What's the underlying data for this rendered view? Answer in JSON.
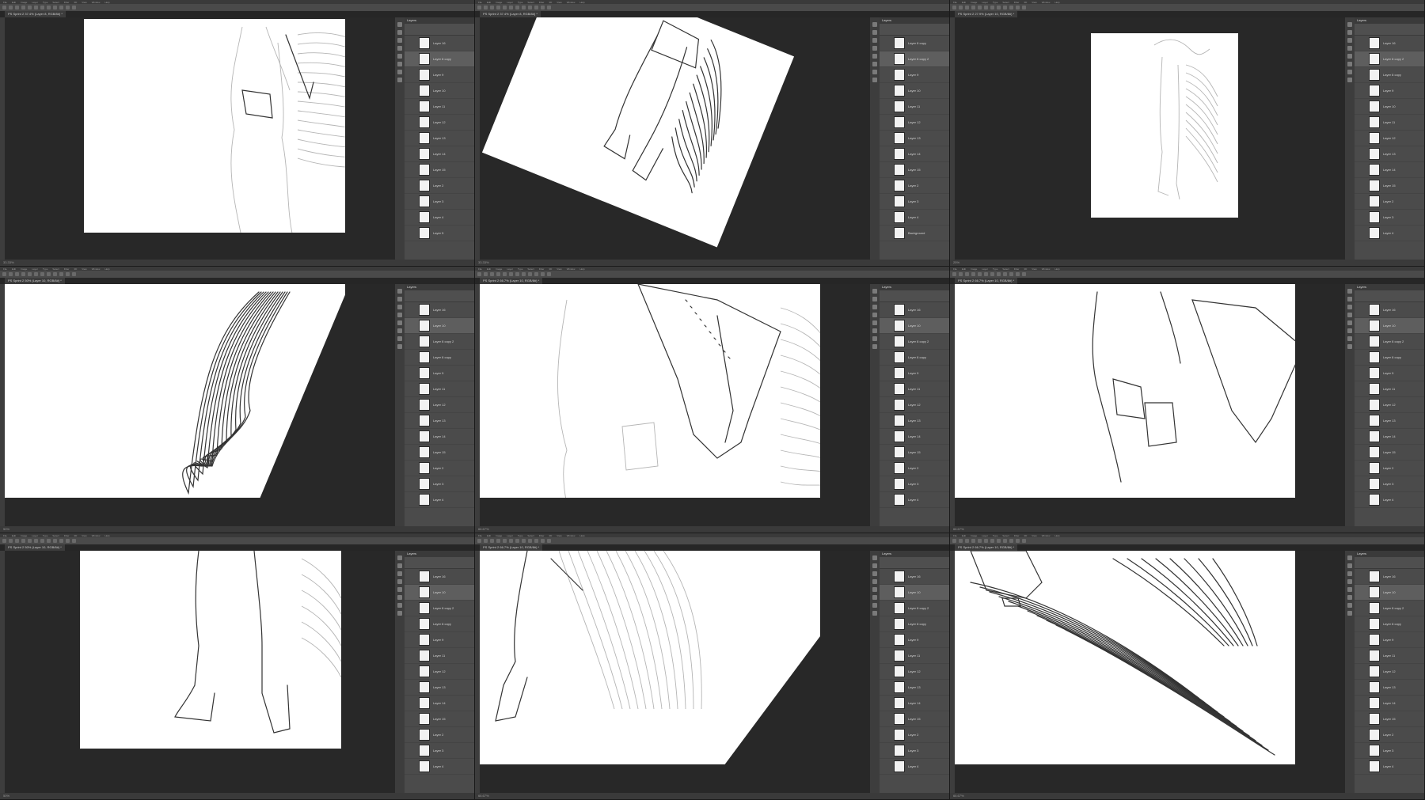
{
  "app": {
    "menu_items": [
      "File",
      "Edit",
      "Image",
      "Layer",
      "Type",
      "Select",
      "Filter",
      "3D",
      "View",
      "Window",
      "Help"
    ],
    "layers_panel_title": "Layers"
  },
  "cells": [
    {
      "doc_tab": "PS Sprint 2 37.4% (Layer 8, RGB/8#) *",
      "status": "33.33%",
      "layers": [
        "Layer 16",
        "Layer 8 copy",
        "Layer 9",
        "Layer 10",
        "Layer 11",
        "Layer 12",
        "Layer 13",
        "Layer 14",
        "Layer 15",
        "Layer 2",
        "Layer 3",
        "Layer 4",
        "Layer 5"
      ]
    },
    {
      "doc_tab": "PS Sprint 2 37.4% (Layer 8, RGB/8#) *",
      "status": "33.33%",
      "layers": [
        "Layer 8 copy",
        "Layer 8 copy 2",
        "Layer 9",
        "Layer 10",
        "Layer 11",
        "Layer 12",
        "Layer 13",
        "Layer 14",
        "Layer 15",
        "Layer 2",
        "Layer 3",
        "Layer 4",
        "Background"
      ]
    },
    {
      "doc_tab": "PS Sprint 2 27.9% (Layer 10, RGB/8#) *",
      "status": "25%",
      "layers": [
        "Layer 16",
        "Layer 8 copy 2",
        "Layer 8 copy",
        "Layer 9",
        "Layer 10",
        "Layer 11",
        "Layer 12",
        "Layer 13",
        "Layer 14",
        "Layer 15",
        "Layer 2",
        "Layer 3",
        "Layer 4"
      ]
    },
    {
      "doc_tab": "PS Sprint 2 50% (Layer 10, RGB/8#) *",
      "status": "50%",
      "layers": [
        "Layer 16",
        "Layer 10",
        "Layer 8 copy 2",
        "Layer 8 copy",
        "Layer 9",
        "Layer 11",
        "Layer 12",
        "Layer 13",
        "Layer 14",
        "Layer 15",
        "Layer 2",
        "Layer 3",
        "Layer 4"
      ]
    },
    {
      "doc_tab": "PS Sprint 2 66.7% (Layer 10, RGB/8#) *",
      "status": "66.67%",
      "layers": [
        "Layer 16",
        "Layer 10",
        "Layer 8 copy 2",
        "Layer 8 copy",
        "Layer 9",
        "Layer 11",
        "Layer 12",
        "Layer 13",
        "Layer 14",
        "Layer 15",
        "Layer 2",
        "Layer 3",
        "Layer 4"
      ]
    },
    {
      "doc_tab": "PS Sprint 2 66.7% (Layer 10, RGB/8#) *",
      "status": "66.67%",
      "layers": [
        "Layer 16",
        "Layer 10",
        "Layer 8 copy 2",
        "Layer 8 copy",
        "Layer 9",
        "Layer 11",
        "Layer 12",
        "Layer 13",
        "Layer 14",
        "Layer 15",
        "Layer 2",
        "Layer 3",
        "Layer 4"
      ]
    },
    {
      "doc_tab": "PS Sprint 2 50% (Layer 10, RGB/8#) *",
      "status": "50%",
      "layers": [
        "Layer 16",
        "Layer 10",
        "Layer 8 copy 2",
        "Layer 8 copy",
        "Layer 9",
        "Layer 11",
        "Layer 12",
        "Layer 13",
        "Layer 14",
        "Layer 15",
        "Layer 2",
        "Layer 3",
        "Layer 4"
      ]
    },
    {
      "doc_tab": "PS Sprint 2 66.7% (Layer 10, RGB/8#) *",
      "status": "66.67%",
      "layers": [
        "Layer 16",
        "Layer 10",
        "Layer 8 copy 2",
        "Layer 8 copy",
        "Layer 9",
        "Layer 11",
        "Layer 12",
        "Layer 13",
        "Layer 14",
        "Layer 15",
        "Layer 2",
        "Layer 3",
        "Layer 4"
      ]
    },
    {
      "doc_tab": "PS Sprint 2 66.7% (Layer 10, RGB/8#) *",
      "status": "66.67%",
      "layers": [
        "Layer 16",
        "Layer 10",
        "Layer 8 copy 2",
        "Layer 8 copy",
        "Layer 9",
        "Layer 11",
        "Layer 12",
        "Layer 13",
        "Layer 14",
        "Layer 15",
        "Layer 2",
        "Layer 3",
        "Layer 4"
      ]
    }
  ]
}
